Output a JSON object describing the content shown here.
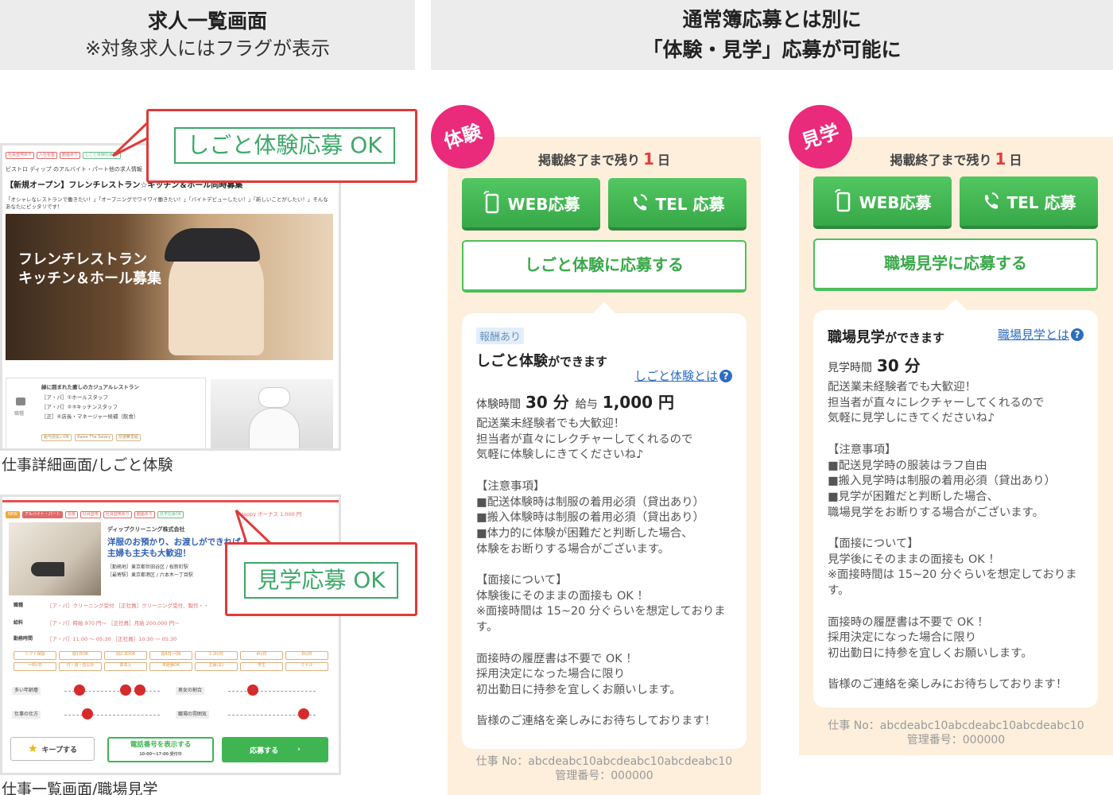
{
  "left_header": {
    "title": "求人一覧画面",
    "subtitle": "※対象求人にはフラグが表示"
  },
  "right_header": {
    "line1": "通常簿応募とは別に",
    "line2": "「体験・見学」応募が可能に"
  },
  "mock_top": {
    "tags": [
      "社員登用あり",
      "入社祝金",
      "動画あり",
      "しごと体験応募OK"
    ],
    "breadcrumb": "ビストロ ディップ のアルバイト・パート他の求人情報",
    "job_title": "【新規オープン】フレンチレストラン☆キッチン＆ホール同時募集",
    "intro": "「オシャレなレストランで働きたい！」「オープニングでワイワイ働きたい！」「バイトデビューしたい！」「新しいことがしたい！」そんなあなたにピッタリです！",
    "hero_line1": "フレンチレストラン",
    "hero_line2": "キッチン＆ホール募集",
    "side_label": "職種",
    "company_line": "緑に囲まれた癒しのカジュアルレストラン",
    "job1": "［ア・パ］①ホールスタッフ",
    "job2": "［ア・パ］②③キッチンスタッフ",
    "job3": "［正］④店長・マネージャー候補（飲食）",
    "bottom_tags": [
      "給与前払いOK",
      "Raise The Salary",
      "交通費支給"
    ]
  },
  "callout_top": "しごと体験応募 OK",
  "caption_top": "仕事詳細画面/しごと体験",
  "mock_bottom": {
    "tags": [
      "NEW",
      "アルバイト・パート",
      "派遣",
      "社員登用",
      "社員登用あり",
      "動画あり",
      "見学応募OK"
    ],
    "bonus": "Happy ボーナス 1,000 円",
    "company": "ディップクリーニング株式会社",
    "headline1": "洋服のお預かり、お渡しができれば OK",
    "headline2": "主婦も主夫も大歓迎！",
    "loc1": "［勤務地］東京都世田谷区 / 桜新町駅",
    "loc2": "［最寄駅］東京都港区 / 六本木一丁目駅",
    "row1_label": "職種",
    "row1_value": "［ア・パ］クリーニング受付 ［正社員］クリーニング受付、製作・・",
    "row2_label": "給料",
    "row2_value": "［ア・パ］時給 970 円〜 ［正社員］月給 200,000 円〜",
    "row3_label": "勤務時間",
    "row3_value": "［ア・パ］11:00 〜 05:30 ［正社員］10:30 〜 05:30",
    "grid": [
      "シフト相談",
      "週1日OK",
      "週2-3DOK",
      "週4日〜OK",
      "1-2h/日",
      "4h/日",
      "6h/日",
      "〜6h/日",
      "日・週・昼以外",
      "高収入",
      "未経験OK",
      "主婦(夫)",
      "学生",
      "ミドル"
    ],
    "scale1_label": "多い年齢層",
    "scale2_label": "仕事の仕方",
    "scale3_label": "男女の割合",
    "scale4_label": "職場の雰囲気",
    "keep": "キープする",
    "phone": "電話番号を表示する",
    "phone_sub": "10:00〜17:00 受付中",
    "apply": "応募する"
  },
  "callout_bottom": "見学応募 OK",
  "caption_bottom": "仕事一覧画面/職場見学",
  "panel_taiken": {
    "badge": "体験",
    "remain_prefix": "掲載終了まで残り",
    "remain_num": "1",
    "remain_suffix": "日",
    "web_btn": "WEB応募",
    "tel_btn": "TEL 応募",
    "main_btn": "しごと体験に応募する",
    "pill": "報酬あり",
    "title_main": "しごと体験",
    "title_sub": "ができます",
    "link": "しごと体験とは",
    "meta1_label": "体験時間",
    "meta1_value": "30 分",
    "meta2_label": "給与",
    "meta2_value": "1,000 円",
    "body": "配送業未経験者でも大歓迎！\n担当者が直々にレクチャーしてくれるので\n気軽に体験しにきてくださいね♪\n\n【注意事項】\n■配送体験時は制服の着用必須（貸出あり）\n■搬入体験時は制服の着用必須（貸出あり）\n■体力的に体験が困難だと判断した場合、\n体験をお断りする場合がございます。\n\n【面接について】\n体験後にそのままの面接も OK ！\n※面接時間は 15~20 分ぐらいを想定しておりま\nす。\n\n面接時の履歴書は不要で OK ！\n採用決定になった場合に限り\n初出勤日に持参を宜しくお願いします。\n\n皆様のご連絡を楽しみにお待ちしております！",
    "job_no": "仕事 No：abcdeabc10abcdeabc10abcdeabc10",
    "manage_no": "管理番号：000000"
  },
  "panel_kengaku": {
    "badge": "見学",
    "remain_prefix": "掲載終了まで残り",
    "remain_num": "1",
    "remain_suffix": "日",
    "web_btn": "WEB応募",
    "tel_btn": "TEL 応募",
    "main_btn": "職場見学に応募する",
    "title_main": "職場見学",
    "title_sub": "ができます",
    "link": "職場見学とは",
    "meta1_label": "見学時間",
    "meta1_value": "30 分",
    "body": "配送業未経験者でも大歓迎！\n担当者が直々にレクチャーしてくれるので\n気軽に見学しにきてくださいね♪\n\n【注意事項】\n■配送見学時の服装はラフ自由\n■搬入見学時は制服の着用必須（貸出あり）\n■見学が困難だと判断した場合、\n職場見学をお断りする場合がございます。\n\n【面接について】\n見学後にそのままの面接も OK ！\n※面接時間は 15~20 分ぐらいを想定しておりま\nす。\n\n面接時の履歴書は不要で OK ！\n採用決定になった場合に限り\n初出勤日に持参を宜しくお願いします。\n\n皆様のご連絡を楽しみにお待ちしております！",
    "job_no": "仕事 No：abcdeabc10abcdeabc10abcdeabc10",
    "manage_no": "管理番号：000000"
  },
  "colors": {
    "accent_pink": "#ea2a7b",
    "button_green": "#3fb552",
    "callout_red": "#e03a3a",
    "remain_red": "#e63b3b",
    "panel_bg": "#fdefdc",
    "link_blue": "#2d6dbf"
  },
  "icons": [
    "mobile-phone-icon",
    "telephone-icon",
    "question-circle-icon",
    "star-icon",
    "bag-icon",
    "mascot-icon",
    "chevron-right-icon"
  ]
}
